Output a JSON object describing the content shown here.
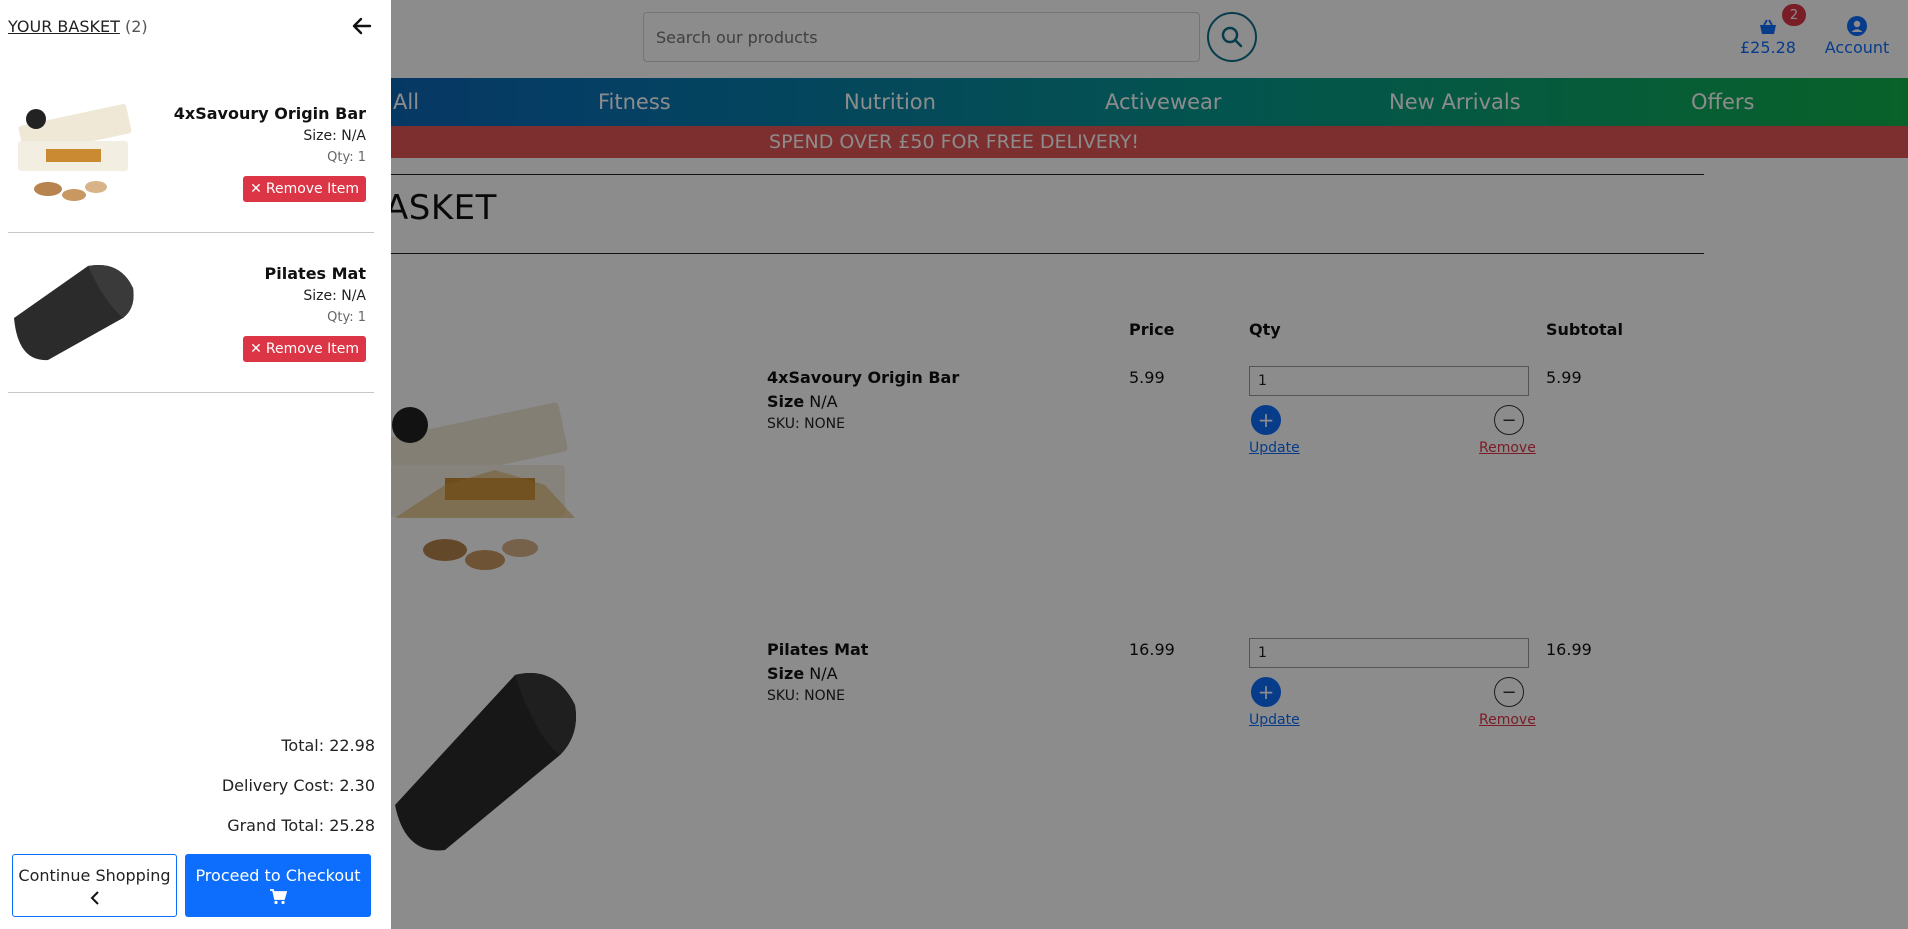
{
  "header": {
    "search_placeholder": "Search our products",
    "basket_total": "£25.28",
    "basket_count": "2",
    "account_label": "Account"
  },
  "nav": {
    "items": [
      "All",
      "Fitness",
      "Nutrition",
      "Activewear",
      "New Arrivals",
      "Offers"
    ]
  },
  "promo": "SPEND OVER £50 FOR FREE DELIVERY!",
  "basket_page": {
    "title": "ASKET",
    "columns": {
      "price": "Price",
      "qty": "Qty",
      "subtotal": "Subtotal"
    },
    "update_label": "Update",
    "remove_label": "Remove",
    "items": [
      {
        "name": "4xSavoury Origin Bar",
        "size_label": "Size",
        "size": "N/A",
        "sku": "SKU: NONE",
        "price": "5.99",
        "qty": "1",
        "subtotal": "5.99"
      },
      {
        "name": "Pilates Mat",
        "size_label": "Size",
        "size": "N/A",
        "sku": "SKU: NONE",
        "price": "16.99",
        "qty": "1",
        "subtotal": "16.99"
      }
    ]
  },
  "drawer": {
    "title": "YOUR BASKET",
    "count": "(2)",
    "items": [
      {
        "name": "4xSavoury Origin Bar",
        "size": "Size: N/A",
        "qty": "Qty: 1",
        "remove": "Remove Item"
      },
      {
        "name": "Pilates Mat",
        "size": "Size: N/A",
        "qty": "Qty: 1",
        "remove": "Remove Item"
      }
    ],
    "total": "Total: 22.98",
    "delivery": "Delivery Cost: 2.30",
    "grand_total": "Grand Total: 25.28",
    "continue_label": "Continue Shopping",
    "checkout_label": "Proceed to Checkout"
  },
  "colors": {
    "primary": "#0d6efd",
    "danger": "#dc3545",
    "promo": "#e35555",
    "nav_start": "#0d4fb0",
    "nav_end": "#10b24a"
  },
  "icons": [
    "search-icon",
    "basket-icon",
    "account-icon",
    "arrow-left-icon",
    "close-icon",
    "chevron-left-icon",
    "cart-icon",
    "plus-icon",
    "minus-icon"
  ]
}
